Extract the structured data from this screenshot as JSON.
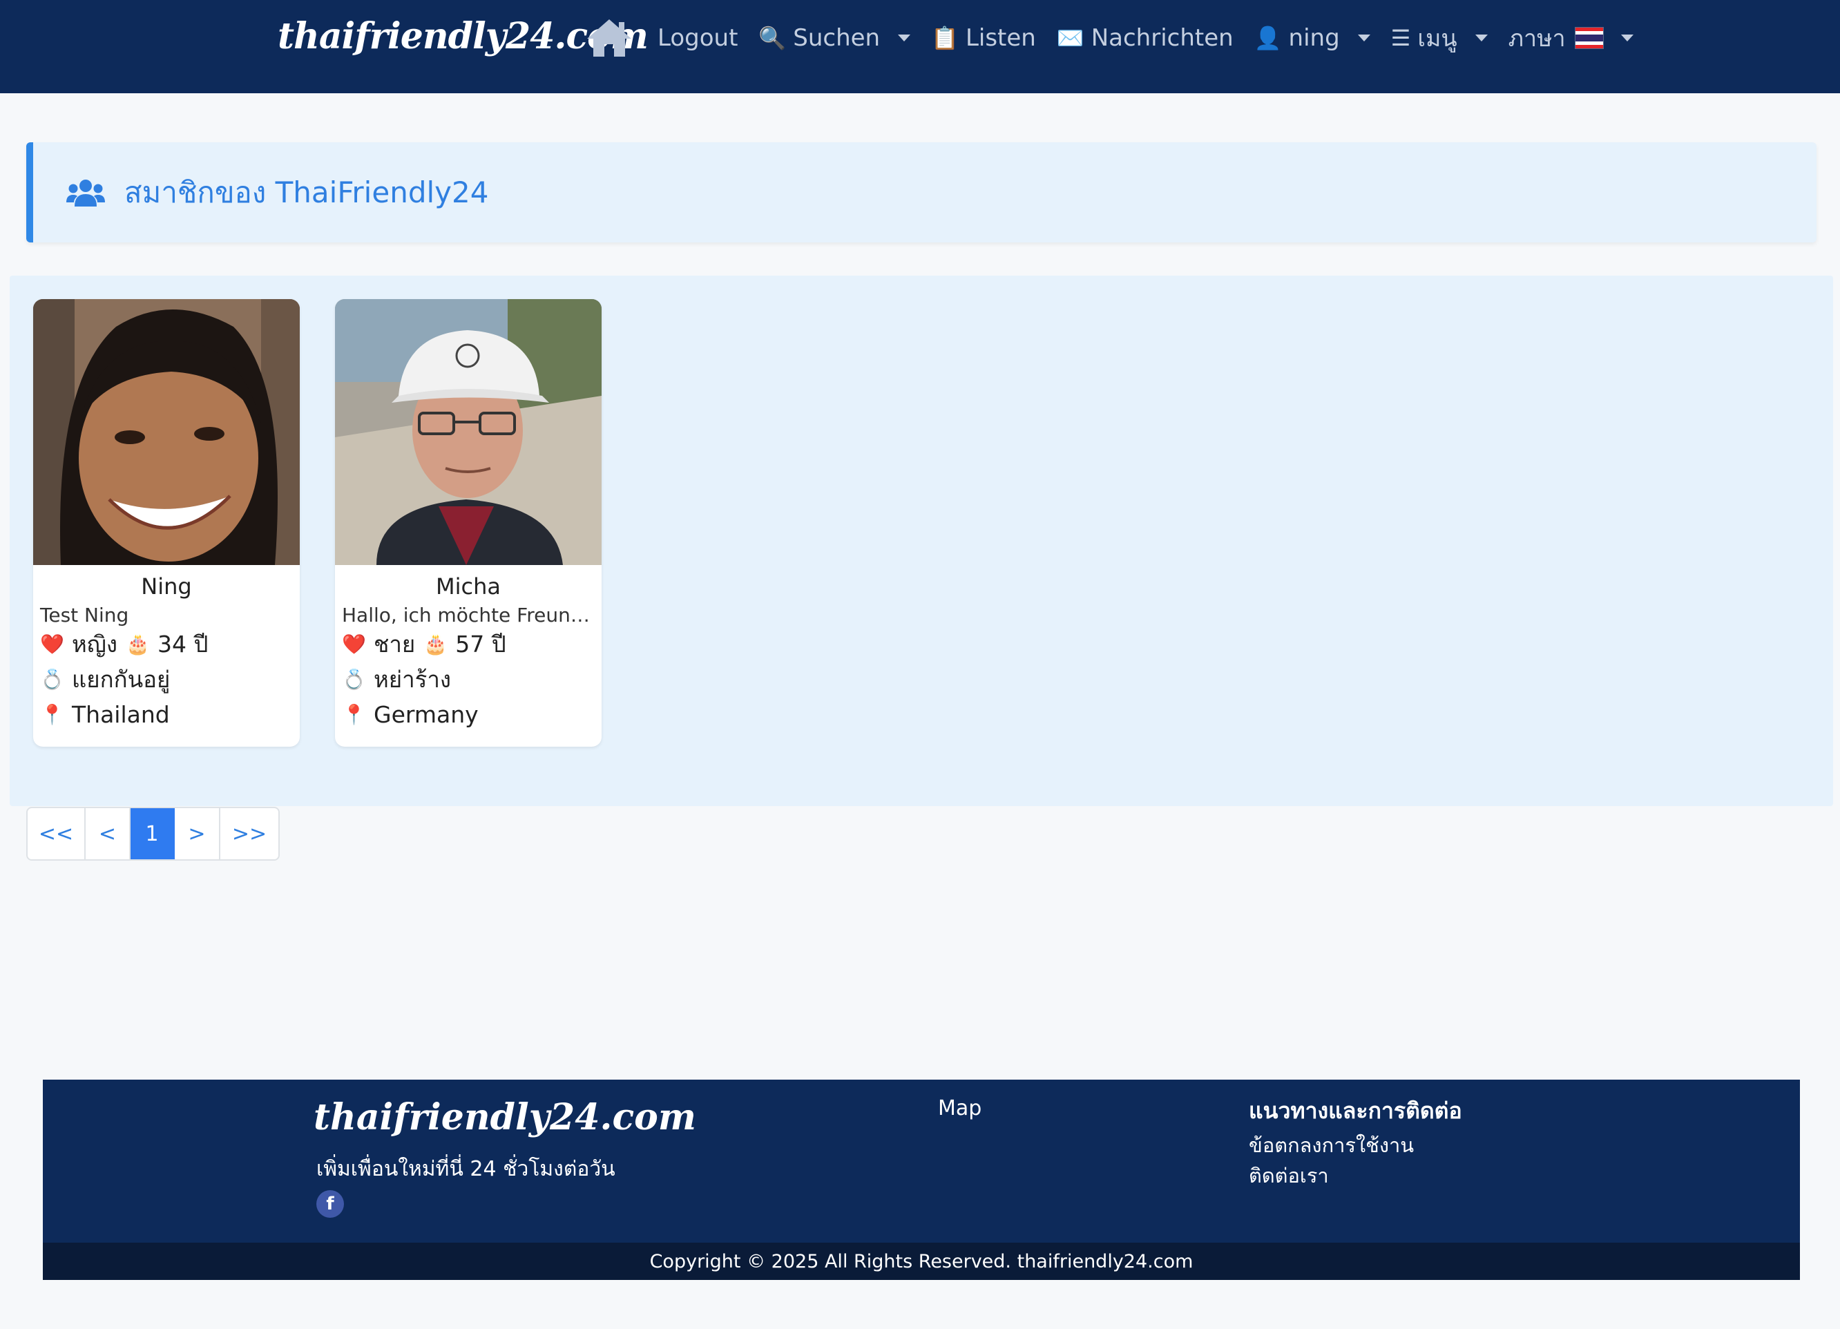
{
  "navbar": {
    "brand": "thaifriendly24.com",
    "items": [
      {
        "label": "Logout",
        "icon": "",
        "dropdown": false
      },
      {
        "label": "Suchen",
        "icon": "🔍",
        "dropdown": true
      },
      {
        "label": "Listen",
        "icon": "📋",
        "dropdown": false
      },
      {
        "label": "Nachrichten",
        "icon": "✉️",
        "dropdown": false
      },
      {
        "label": "ning",
        "icon": "👤",
        "dropdown": true
      },
      {
        "label": "เมนู",
        "icon": "☰",
        "dropdown": true
      },
      {
        "label": "ภาษา",
        "icon": "",
        "dropdown": true
      }
    ]
  },
  "page_header": {
    "title": "สมาชิกของ ThaiFriendly24"
  },
  "members": [
    {
      "name": "Ning",
      "tagline": "Test Ning",
      "gender_icon": "❤️",
      "gender": "หญิง",
      "age_icon": "🎂",
      "age": "34 ปี",
      "status_icon": "💍",
      "status": "แยกกันอยู่",
      "location_icon": "📍",
      "location": "Thailand"
    },
    {
      "name": "Micha",
      "tagline": "Hallo, ich möchte Freunde...",
      "gender_icon": "❤️",
      "gender": "ชาย",
      "age_icon": "🎂",
      "age": "57 ปี",
      "status_icon": "💍",
      "status": "หย่าร้าง",
      "location_icon": "📍",
      "location": "Germany"
    }
  ],
  "pagination": {
    "first": "<<",
    "prev": "<",
    "current": "1",
    "next": ">",
    "last": ">>"
  },
  "footer": {
    "brand": "thaifriendly24.com",
    "tagline": "เพิ่มเพื่อนใหม่ที่นี่ 24 ชั่วโมงต่อวัน",
    "facebook_icon": "f",
    "map_link": "Map",
    "contact_title": "แนวทางและการติดต่อ",
    "links": [
      "ข้อตกลงการใช้งาน",
      "ติดต่อเรา"
    ],
    "copyright": "Copyright © 2025 All Rights Reserved. thaifriendly24.com"
  },
  "colors": {
    "navbar_bg": "#0d2a5a",
    "accent": "#2f7fe0",
    "panel_bg": "#e6f2fc",
    "active_page": "#2f7bf0"
  }
}
